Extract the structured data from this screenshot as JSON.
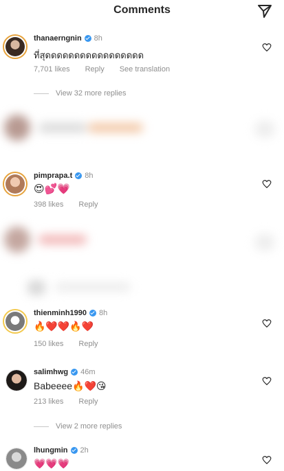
{
  "header": {
    "title": "Comments",
    "send_icon": "paper-plane-icon"
  },
  "comments": [
    {
      "username": "thanaerngnin",
      "verified": true,
      "time": "8h",
      "text": "ที่สุดดดดดดดดดดดดดดดดด",
      "likes": "7,701 likes",
      "reply": "Reply",
      "translate": "See translation",
      "view_replies": "View 32 more replies"
    },
    {
      "username": "pimprapa.t",
      "verified": true,
      "time": "8h",
      "text": "😍💕💗",
      "likes": "398 likes",
      "reply": "Reply"
    },
    {
      "username": "thienminh1990",
      "verified": true,
      "time": "8h",
      "text": "🔥❤️❤️🔥❤️",
      "likes": "150 likes",
      "reply": "Reply"
    },
    {
      "username": "salimhwg",
      "verified": true,
      "time": "46m",
      "text": "Babeeee🔥❤️😘",
      "likes": "213 likes",
      "reply": "Reply",
      "view_replies": "View 2 more replies"
    },
    {
      "username": "lhungmin",
      "verified": true,
      "time": "2h",
      "text": "💗💗💗"
    }
  ],
  "colors": {
    "verified": "#3897f0",
    "muted": "#8e8e8e",
    "text": "#262626"
  }
}
